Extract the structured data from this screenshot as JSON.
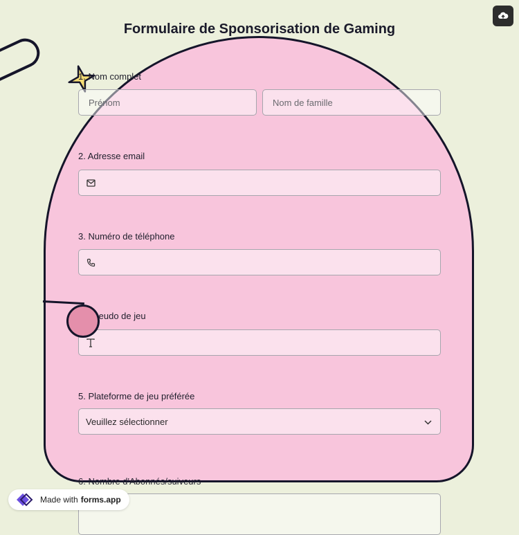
{
  "form": {
    "title": "Formulaire de Sponsorisation de Gaming",
    "questions": [
      {
        "label": "1. Nom complet",
        "first_placeholder": "Prénom",
        "last_placeholder": "Nom de famille"
      },
      {
        "label": "2. Adresse email"
      },
      {
        "label": "3. Numéro de téléphone"
      },
      {
        "label": "4. Pseudo de jeu"
      },
      {
        "label": "5. Plateforme de jeu préférée",
        "selected": "Veuillez sélectionner"
      },
      {
        "label": "6. Nombre d'Abonnés/suiveurs"
      }
    ]
  },
  "badge": {
    "prefix": "Made with",
    "brand": "forms.app"
  },
  "icons": [
    "upload-cloud-icon",
    "envelope-icon",
    "phone-icon",
    "text-icon",
    "chevron-down-icon",
    "forms-app-logo-icon",
    "sparkle-star-icon"
  ],
  "colors": {
    "background": "#ecf0dc",
    "arch": "#f8c5dc",
    "outline": "#15152a",
    "star": "#f4dc74",
    "circle": "#e48fab"
  }
}
